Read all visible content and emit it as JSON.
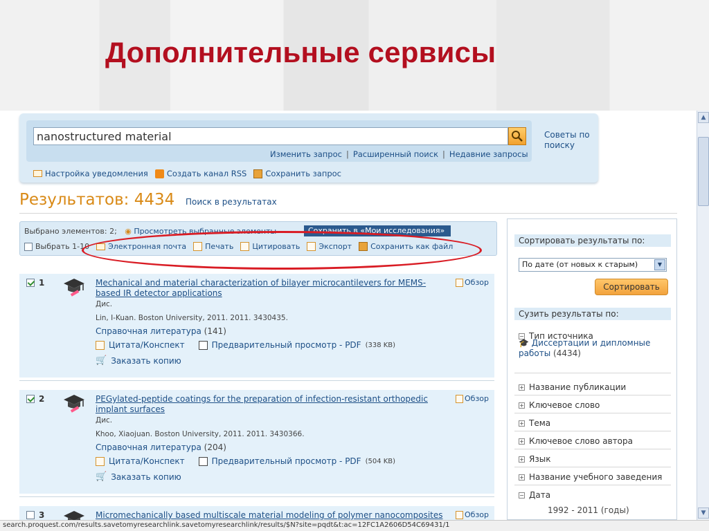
{
  "slide": {
    "title": "Дополнительные сервисы"
  },
  "search": {
    "value": "nanostructured material",
    "links": [
      "Изменить запрос",
      "Расширенный поиск",
      "Недавние запросы"
    ],
    "tips": "Советы по поиску",
    "actions": [
      "Настройка уведомления",
      "Создать канал RSS",
      "Сохранить запрос"
    ]
  },
  "results": {
    "title": "Результатов: 4434",
    "search_within": "Поиск в результатах"
  },
  "toolbar": {
    "selected": "Выбрано элементов: 2;",
    "view_selected": "Просмотреть выбранные элементы",
    "save_to": "Сохранить в «Мои исследования»",
    "select_range": "Выбрать 1-10",
    "email": "Электронная почта",
    "print": "Печать",
    "cite": "Цитировать",
    "export": "Экспорт",
    "save_file": "Сохранить как файл"
  },
  "items": [
    {
      "num": "1",
      "title": "Mechanical and material characterization of bilayer microcantilevers for MEMS-based IR detector applications",
      "overview": "Обзор",
      "type": "Дис.",
      "meta": "Lin, I-Kuan. Boston University, 2011. 2011. 3430435.",
      "ref_label": "Справочная литература",
      "ref_count": "(141)",
      "cite_label": "Цитата/Конспект",
      "pdf_label": "Предварительный просмотр - PDF",
      "pdf_size": "(338 KB)",
      "order_label": "Заказать копию"
    },
    {
      "num": "2",
      "title": "PEGylated-peptide coatings for the preparation of infection-resistant orthopedic implant surfaces",
      "overview": "Обзор",
      "type": "Дис.",
      "meta": "Khoo, Xiaojuan. Boston University, 2011. 2011. 3430366.",
      "ref_label": "Справочная литература",
      "ref_count": "(204)",
      "cite_label": "Цитата/Конспект",
      "pdf_label": "Предварительный просмотр - PDF",
      "pdf_size": "(504 KB)",
      "order_label": "Заказать копию"
    },
    {
      "num": "3",
      "title": "Micromechanically based multiscale material modeling of polymer nanocomposites",
      "overview": "Обзор"
    }
  ],
  "sidebar": {
    "sort_heading": "Сортировать результаты по:",
    "sort_value": "По дате (от новых к старым)",
    "sort_button": "Сортировать",
    "narrow_heading": "Сузить результаты по:",
    "source_type": "Тип источника",
    "diss_label": "Диссертации и дипломные работы",
    "diss_count": "(4434)",
    "facets": [
      "Название публикации",
      "Ключевое слово",
      "Тема",
      "Ключевое слово автора",
      "Язык",
      "Название учебного заведения",
      "Дата"
    ],
    "years": "1992 - 2011 (годы)"
  },
  "statusbar": {
    "url": "search.proquest.com/results.savetomyresearchlink.savetomyresearchlink/results/$N?site=pqdt&t:ac=12FC1A2606D54C69431/1"
  },
  "colors": {
    "title_red": "#b30f1f",
    "accent_orange": "#d98a17",
    "link_blue": "#1d4f86",
    "panel_blue": "#dcebf6",
    "oval_red": "#d91c24"
  }
}
